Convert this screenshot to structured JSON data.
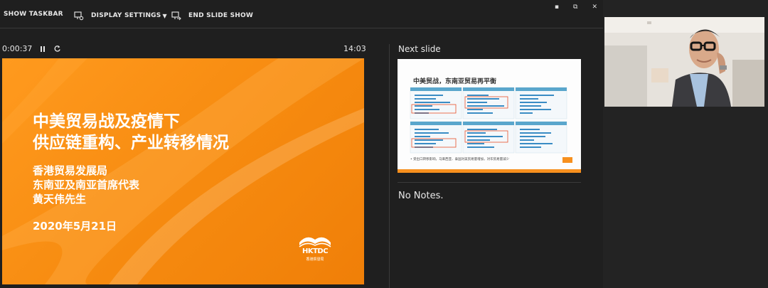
{
  "toolbar": {
    "show_taskbar": "SHOW TASKBAR",
    "display_settings": "DISPLAY SETTINGS",
    "end_slide_show": "END SLIDE SHOW"
  },
  "window": {
    "minimize": "▪",
    "restore": "⧉",
    "close": "✕"
  },
  "timer": {
    "elapsed": "0:00:37",
    "clock": "14:03"
  },
  "current_slide": {
    "title_line1": "中美贸易战及疫情下",
    "title_line2": "供应链重构、产业转移情况",
    "org": "香港贸易发展局",
    "role": "东南亚及南亚首席代表",
    "speaker": "黄天伟先生",
    "date": "2020年5月21日",
    "logo_text": "HKTDC",
    "logo_cn": "香港貿發局"
  },
  "next_slide": {
    "label": "Next slide",
    "title": "中美贸战，东南亚贸易再平衡",
    "bullet": "•  受出口转移影响，马来西亚、泰国对美贸易量增加，对华贸易量减少"
  },
  "notes": {
    "text": "No Notes."
  },
  "colors": {
    "accent_orange": "#f7901e",
    "background": "#1f1f1f"
  },
  "icons": {
    "display_settings": "monitor-gear-icon",
    "end_slide_show": "monitor-exit-icon",
    "pause": "pause-icon",
    "restart": "restart-icon"
  }
}
